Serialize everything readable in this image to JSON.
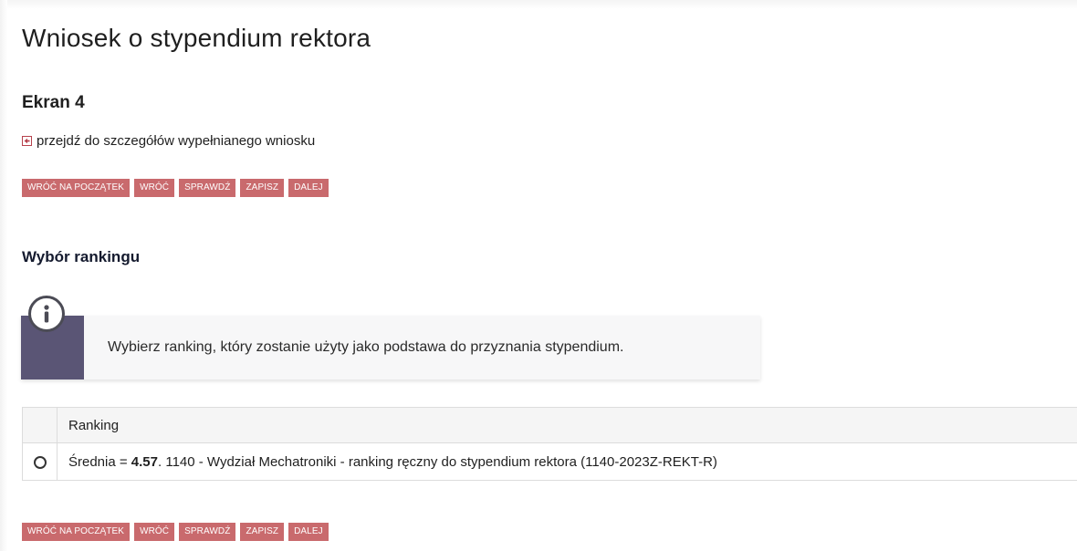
{
  "page": {
    "title": "Wniosek o stypendium rektora",
    "screen_label": "Ekran 4",
    "details_link": "przejdź do szczegółów wypełnianego wniosku"
  },
  "buttons": {
    "back_to_start": "WRÓĆ NA POCZĄTEK",
    "back": "WRÓĆ",
    "check": "SPRAWDŹ",
    "save": "ZAPISZ",
    "next": "DALEJ"
  },
  "section": {
    "title": "Wybór rankingu"
  },
  "info": {
    "text": "Wybierz ranking, który zostanie użyty jako podstawa do przyznania stypendium.",
    "icon": "info-icon"
  },
  "table": {
    "header": "Ranking",
    "rows": [
      {
        "prefix": "Średnia = ",
        "average": "4.57",
        "description": ". 1140 - Wydział Mechatroniki - ranking ręczny do stypendium rektora (1140-2023Z-REKT-R)",
        "selected": false
      }
    ]
  },
  "colors": {
    "button_bg": "#c96a6d",
    "info_band": "#5a5575",
    "section_title": "#141a2e"
  }
}
